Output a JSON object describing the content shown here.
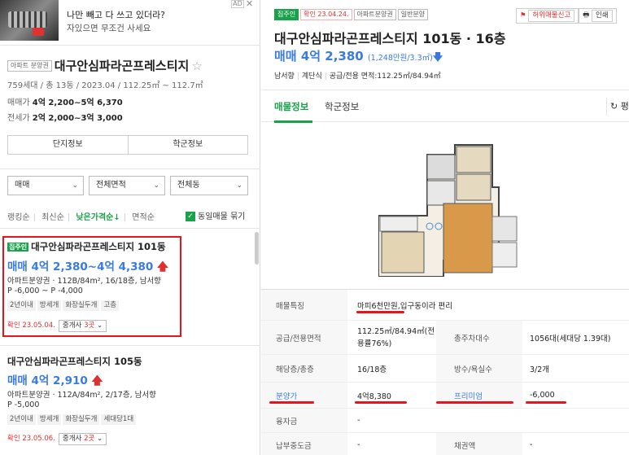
{
  "ad": {
    "line1": "나만 빼고 다 쓰고 있더라?",
    "line2": "자있으면 무조건 사세요",
    "tag": "AD",
    "close": "✕"
  },
  "complex": {
    "type_tag": "아파트 분양권",
    "name": "대구안심파라곤프레스티지",
    "star": "☆",
    "meta": "759세대 / 총 13동 / 2023.04 / 112.25㎡ ~ 112.7㎡",
    "sale_label": "매매가",
    "sale_value": "4억 2,200~5억 6,370",
    "jeonse_label": "전세가",
    "jeonse_value": "2억 2,000~3억 3,000",
    "btn_info": "단지정보",
    "btn_school": "학군정보"
  },
  "filters": {
    "trade": "매매",
    "area": "전체면적",
    "dong": "전체동",
    "chevron": "⌄"
  },
  "sort": {
    "items": [
      "랭킹순",
      "최신순",
      "낮은가격순↓",
      "면적순"
    ],
    "group_label": "동일매물 묶기",
    "check": "✓"
  },
  "listings": [
    {
      "badge": "집주인",
      "title": "대구안심파라곤프레스티지 101동",
      "price": "매매 4억 2,380~4억 4,380",
      "arrow": "🡅",
      "spec": "아파트분양권 · 112B/84m², 16/18층, 남서향",
      "pp": "P -6,000 ~ P -4,000",
      "chips": [
        "2년이내",
        "방세개",
        "화장실두개",
        "고층"
      ],
      "confirm": "확인 23.05.04.",
      "agent_label": "중개사",
      "agent_count": "3곳",
      "agent_chev": "⌄"
    },
    {
      "badge": "",
      "title": "대구안심파라곤프레스티지 105동",
      "price": "매매 4억 2,910",
      "arrow": "🡅",
      "spec": "아파트분양권 · 112A/84m², 2/17층, 남서향",
      "pp": "P -5,000",
      "chips": [
        "2년이내",
        "방세개",
        "화장실두개",
        "세대당1대"
      ],
      "confirm": "확인 23.05.06.",
      "agent_label": "중개사",
      "agent_count": "2곳",
      "agent_chev": "⌄"
    }
  ],
  "detail": {
    "tags": [
      "집주인",
      "확인 23.04.24.",
      "아파트분양권",
      "일반분양"
    ],
    "report": "허위매물신고",
    "print": "인쇄",
    "title": "대구안심파라곤프레스티지 101동 · 16층",
    "price": "매매 4억 2,380",
    "price_unit": "(1,248만원/3.3㎡)",
    "price_arrow": "🡇",
    "sub": [
      "남서향",
      "계단식",
      "공급/전용 면적:112.25㎡/84.94㎡"
    ],
    "tabs": [
      "매물정보",
      "학군정보"
    ],
    "tab_right": "↻ 평",
    "rows": [
      {
        "k": "매물특징",
        "v": "마피6천만원,입구동이라 편리",
        "k2": "",
        "v2": ""
      },
      {
        "k": "공급/전용면적",
        "v": "112.25㎡/84.94㎡(전용률76%)",
        "k2": "총주차대수",
        "v2": "1056대(세대당 1.39대)"
      },
      {
        "k": "해당층/총층",
        "v": "16/18층",
        "k2": "방수/욕실수",
        "v2": "3/2개"
      },
      {
        "k": "분양가",
        "v": "4억8,380",
        "k2": "프리미엄",
        "v2": "-6,000"
      },
      {
        "k": "융자금",
        "v": "-",
        "k2": "",
        "v2": ""
      },
      {
        "k": "납부중도금",
        "v": "-",
        "k2": "채권액",
        "v2": "-"
      }
    ]
  }
}
